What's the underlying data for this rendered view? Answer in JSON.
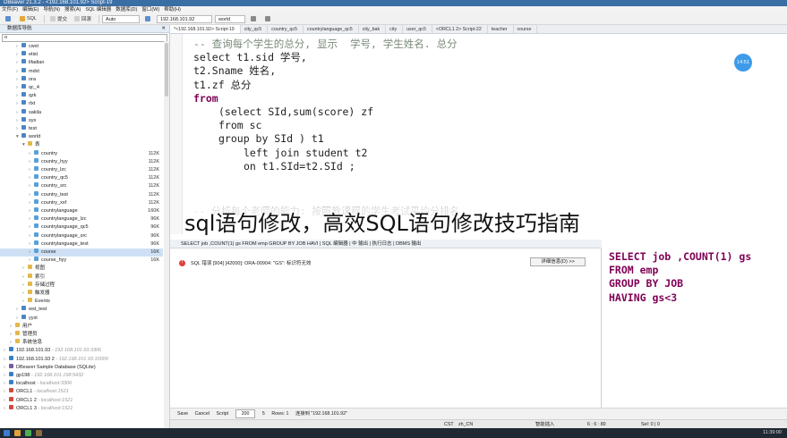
{
  "titlebar": {
    "text": "DBeaver 21.3.2 - <192.168.101.92> Script-19"
  },
  "menubar": {
    "items": [
      "文件(F)",
      "编辑(E)",
      "导航(N)",
      "搜索(A)",
      "SQL 编辑器",
      "数据库(D)",
      "窗口(W)",
      "帮助(H)"
    ]
  },
  "toolbar": {
    "sql_label": "SQL",
    "commit_label": "提交",
    "rollback_label": "回滚",
    "auto_label": "Auto",
    "connection": "192.168.101.92",
    "schema": "world"
  },
  "navigator": {
    "title": "数据库导航",
    "filter_value": "o",
    "rows": [
      {
        "label": "cwxt",
        "size": "",
        "color": "#4a86c5",
        "indent": 1,
        "toggle": ">"
      },
      {
        "label": "etist",
        "size": "",
        "color": "#4a86c5",
        "indent": 1,
        "toggle": ">"
      },
      {
        "label": "lifadian",
        "size": "",
        "color": "#4a86c5",
        "indent": 1,
        "toggle": ">"
      },
      {
        "label": "mdxt",
        "size": "",
        "color": "#4a86c5",
        "indent": 1,
        "toggle": ">"
      },
      {
        "label": "ora",
        "size": "",
        "color": "#4a86c5",
        "indent": 1,
        "toggle": ">"
      },
      {
        "label": "qc_4",
        "size": "",
        "color": "#4a86c5",
        "indent": 1,
        "toggle": ">"
      },
      {
        "label": "qzk",
        "size": "",
        "color": "#4a86c5",
        "indent": 1,
        "toggle": ">"
      },
      {
        "label": "rlxt",
        "size": "",
        "color": "#4a86c5",
        "indent": 1,
        "toggle": ">"
      },
      {
        "label": "sakila",
        "size": "",
        "color": "#4a86c5",
        "indent": 1,
        "toggle": ">"
      },
      {
        "label": "sys",
        "size": "",
        "color": "#4a86c5",
        "indent": 1,
        "toggle": ">"
      },
      {
        "label": "test",
        "size": "",
        "color": "#4a86c5",
        "indent": 1,
        "toggle": ">"
      },
      {
        "label": "world",
        "size": "",
        "color": "#4a86c5",
        "indent": 1,
        "toggle": "v"
      },
      {
        "label": "表",
        "size": "",
        "color": "#e5b84a",
        "indent": 2,
        "toggle": "v"
      },
      {
        "label": "country",
        "size": "112K",
        "color": "#5aa0d8",
        "indent": 3,
        "toggle": ">"
      },
      {
        "label": "country_hyy",
        "size": "112K",
        "color": "#5aa0d8",
        "indent": 3,
        "toggle": ">"
      },
      {
        "label": "country_lzc",
        "size": "112K",
        "color": "#5aa0d8",
        "indent": 3,
        "toggle": ">"
      },
      {
        "label": "country_qc5",
        "size": "112K",
        "color": "#5aa0d8",
        "indent": 3,
        "toggle": ">"
      },
      {
        "label": "country_src",
        "size": "112K",
        "color": "#5aa0d8",
        "indent": 3,
        "toggle": ">"
      },
      {
        "label": "country_test",
        "size": "112K",
        "color": "#5aa0d8",
        "indent": 3,
        "toggle": ">"
      },
      {
        "label": "country_xxf",
        "size": "112K",
        "color": "#5aa0d8",
        "indent": 3,
        "toggle": ">"
      },
      {
        "label": "countrylanguage",
        "size": "160K",
        "color": "#5aa0d8",
        "indent": 3,
        "toggle": ">"
      },
      {
        "label": "countrylanguage_lzc",
        "size": "96K",
        "color": "#5aa0d8",
        "indent": 3,
        "toggle": ">"
      },
      {
        "label": "countrylanguage_qc5",
        "size": "96K",
        "color": "#5aa0d8",
        "indent": 3,
        "toggle": ">"
      },
      {
        "label": "countrylanguage_src",
        "size": "96K",
        "color": "#5aa0d8",
        "indent": 3,
        "toggle": ">"
      },
      {
        "label": "countrylanguage_test",
        "size": "96K",
        "color": "#5aa0d8",
        "indent": 3,
        "toggle": ">"
      },
      {
        "label": "course",
        "size": "16K",
        "color": "#5aa0d8",
        "indent": 3,
        "toggle": ">",
        "selected": true
      },
      {
        "label": "course_hyy",
        "size": "16K",
        "color": "#5aa0d8",
        "indent": 3,
        "toggle": ">"
      },
      {
        "label": "视图",
        "size": "",
        "color": "#e5b84a",
        "indent": 2,
        "toggle": ">"
      },
      {
        "label": "索引",
        "size": "",
        "color": "#e5b84a",
        "indent": 2,
        "toggle": ">"
      },
      {
        "label": "存储过程",
        "size": "",
        "color": "#e5b84a",
        "indent": 2,
        "toggle": ">"
      },
      {
        "label": "触发器",
        "size": "",
        "color": "#e5b84a",
        "indent": 2,
        "toggle": ">"
      },
      {
        "label": "Events",
        "size": "",
        "color": "#e5b84a",
        "indent": 2,
        "toggle": ">"
      },
      {
        "label": "wst_test",
        "size": "",
        "color": "#4a86c5",
        "indent": 1,
        "toggle": ">"
      },
      {
        "label": "yyxt",
        "size": "",
        "color": "#4a86c5",
        "indent": 1,
        "toggle": ">"
      },
      {
        "label": "用户",
        "size": "",
        "color": "#e5b84a",
        "indent": 0,
        "toggle": ">"
      },
      {
        "label": "管理员",
        "size": "",
        "color": "#e5b84a",
        "indent": 0,
        "toggle": ">"
      },
      {
        "label": "系统信息",
        "size": "",
        "color": "#e5b84a",
        "indent": 0,
        "toggle": ">"
      },
      {
        "label": "192.168.101.93",
        "size": "",
        "color": "#3b7fc4",
        "indent": -1,
        "toggle": ">",
        "sub": " - 192.168.101.93:3306"
      },
      {
        "label": "192.168.101.93 2",
        "size": "",
        "color": "#3b7fc4",
        "indent": -1,
        "toggle": ">",
        "sub": " - 192.168.101.93:10000"
      },
      {
        "label": "DBeaver Sample Database (SQLite)",
        "size": "",
        "color": "#7a5aa0",
        "indent": -1,
        "toggle": ">"
      },
      {
        "label": "gp198",
        "size": "",
        "color": "#3b7fc4",
        "indent": -1,
        "toggle": ">",
        "sub": " - 192.168.101.168:5432"
      },
      {
        "label": "localhost",
        "size": "",
        "color": "#3b7fc4",
        "indent": -1,
        "toggle": ">",
        "sub": " - localhost:3306"
      },
      {
        "label": "ORCL1",
        "size": "",
        "color": "#d04a3a",
        "indent": -1,
        "toggle": ">",
        "sub": " - localhost:1521"
      },
      {
        "label": "ORCL1 2",
        "size": "",
        "color": "#d04a3a",
        "indent": -1,
        "toggle": ">",
        "sub": " - localhost:1521"
      },
      {
        "label": "ORCL1 3",
        "size": "",
        "color": "#d04a3a",
        "indent": -1,
        "toggle": ">",
        "sub": " - localhost:1521"
      }
    ]
  },
  "tabs": [
    {
      "label": "*<192.168.101.92> Script-19",
      "active": true
    },
    {
      "label": "city_qc5"
    },
    {
      "label": "country_qc5"
    },
    {
      "label": "countrylanguage_qc5"
    },
    {
      "label": "city_bak"
    },
    {
      "label": "city"
    },
    {
      "label": "user_qc5"
    },
    {
      "label": "<ORCL1 2> Script-22"
    },
    {
      "label": "teacher"
    },
    {
      "label": "course"
    }
  ],
  "editor": {
    "comment1": "-- 查询每个学生的总分, 显示  学号, 学生姓名. 总分",
    "line_select": "select t1.sid 学号,",
    "line_sname": "t2.Sname 姓名,",
    "line_zf": "t1.zf 总分",
    "line_from": "from",
    "line_sub1": "(select SId,sum(score) zf",
    "line_sub2": "from sc",
    "line_sub3": "group by SId ) t1",
    "line_join": "left join student t2",
    "line_on": "on t1.SId=t2.SId ;",
    "comment2": "-- 分析每个老师的能力: 按照教课程的学生考试平均分排名",
    "avatar_text": "14:51"
  },
  "overlay_title": "sql语句修改，高效SQL语句修改技巧指南",
  "results": {
    "query_line": "SELECT job ,COUNT(1) gs FROM emp GROUP BY JOB HAVI  |  SQL 编辑器  |  中 输出  |  执行日志  |  DBMS 输出",
    "error_text": "SQL 错误 [904] [42000]: ORA-00904: \"GS\": 标识符无效",
    "detail_button": "详细信息(D) >>",
    "save": "Save",
    "cancel": "Cancel",
    "script": "Script",
    "limit": "200",
    "rows_count": "5",
    "rows_label": "Rows: 1",
    "connect": "连接到 \"192.168.101.92\""
  },
  "snippet": {
    "l1": "SELECT job ,COUNT(1) gs",
    "l2": "FROM emp",
    "l3": "GROUP BY JOB",
    "l4": "HAVING gs<3"
  },
  "status": {
    "tz": "CST",
    "locale": "zh_CN",
    "mode": "智能插入",
    "pos": "6 : 6 : 80",
    "sel": "Sel: 0 | 0"
  },
  "taskbar": {
    "clock": "11:39:00"
  }
}
